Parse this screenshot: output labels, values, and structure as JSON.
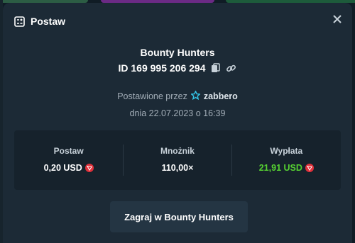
{
  "modal": {
    "title": "Postaw",
    "close_icon": "close-icon",
    "header_icon": "bet-slip-icon"
  },
  "bet": {
    "game_name": "Bounty Hunters",
    "id_text": "ID 169 995 206 294",
    "copy_icon": "copy-icon",
    "link_icon": "link-icon",
    "placed_by_label": "Postawione przez",
    "user_icon": "star-icon",
    "username": "zabbero",
    "date_text": "dnia 22.07.2023 o 16:39"
  },
  "stats": [
    {
      "label": "Postaw",
      "value": "0,20 USD",
      "currency_icon": "trx-coin-icon"
    },
    {
      "label": "Mnożnik",
      "value": "110,00×"
    },
    {
      "label": "Wypłata",
      "value": "21,91 USD",
      "currency_icon": "trx-coin-icon"
    }
  ],
  "colors": {
    "modal_bg": "#1c2a36",
    "panel_bg": "#16222c",
    "payout_green": "#56d132",
    "coin_red": "#e0303a"
  },
  "actions": {
    "play_label": "Zagraj w Bounty Hunters"
  }
}
